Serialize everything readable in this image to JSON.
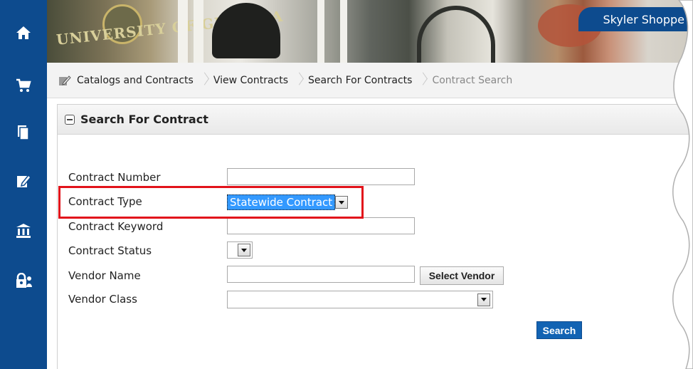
{
  "app": {
    "user_name": "Skyler Shoppe",
    "banner_text": "UNIVERSITY OF GEORGIA"
  },
  "sidebar": {
    "items": [
      {
        "icon": "home-icon"
      },
      {
        "icon": "shopping-cart-icon"
      },
      {
        "icon": "documents-icon"
      },
      {
        "icon": "edit-document-icon"
      },
      {
        "icon": "bank-icon"
      },
      {
        "icon": "lock-user-icon"
      }
    ]
  },
  "breadcrumb": {
    "icon": "catalog-edit-icon",
    "items": [
      {
        "label": "Catalogs and Contracts"
      },
      {
        "label": "View Contracts"
      },
      {
        "label": "Search For Contracts"
      },
      {
        "label": "Contract Search"
      }
    ]
  },
  "panel": {
    "title": "Search For Contract"
  },
  "form": {
    "contract_number": {
      "label": "Contract Number",
      "value": ""
    },
    "contract_type": {
      "label": "Contract Type",
      "value": "Statewide Contract"
    },
    "contract_keyword": {
      "label": "Contract Keyword",
      "value": ""
    },
    "contract_status": {
      "label": "Contract Status",
      "value": ""
    },
    "vendor_name": {
      "label": "Vendor Name",
      "value": "",
      "button_label": "Select Vendor"
    },
    "vendor_class": {
      "label": "Vendor Class",
      "value": ""
    },
    "search_label": "Search"
  },
  "colors": {
    "nav_blue": "#0d4b8e",
    "highlight_red": "#e2131b",
    "selection_blue": "#3399ff",
    "button_blue": "#1263b3"
  }
}
